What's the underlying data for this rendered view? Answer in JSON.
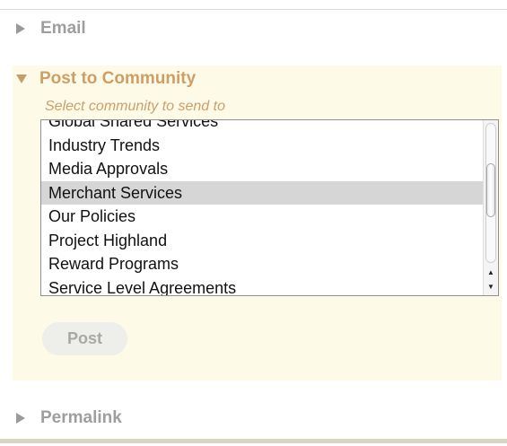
{
  "sections": {
    "email": {
      "label": "Email",
      "expanded": false,
      "icon": "triangle-right-icon"
    },
    "community": {
      "label": "Post to Community",
      "expanded": true,
      "icon": "triangle-down-icon",
      "hint": "Select community to send to",
      "items": [
        "Global Shared Services",
        "Industry Trends",
        "Media Approvals",
        "Merchant Services",
        "Our Policies",
        "Project Highland",
        "Reward Programs",
        "Service Level Agreements"
      ],
      "selected": "Merchant Services",
      "post_label": "Post"
    },
    "permalink": {
      "label": "Permalink",
      "expanded": false,
      "icon": "triangle-right-icon"
    }
  },
  "colors": {
    "active_header": "#cf9e67",
    "inactive_header": "#9e9e9e",
    "panel_background": "#fdfbe8",
    "selected_row": "#d6d6d6"
  }
}
